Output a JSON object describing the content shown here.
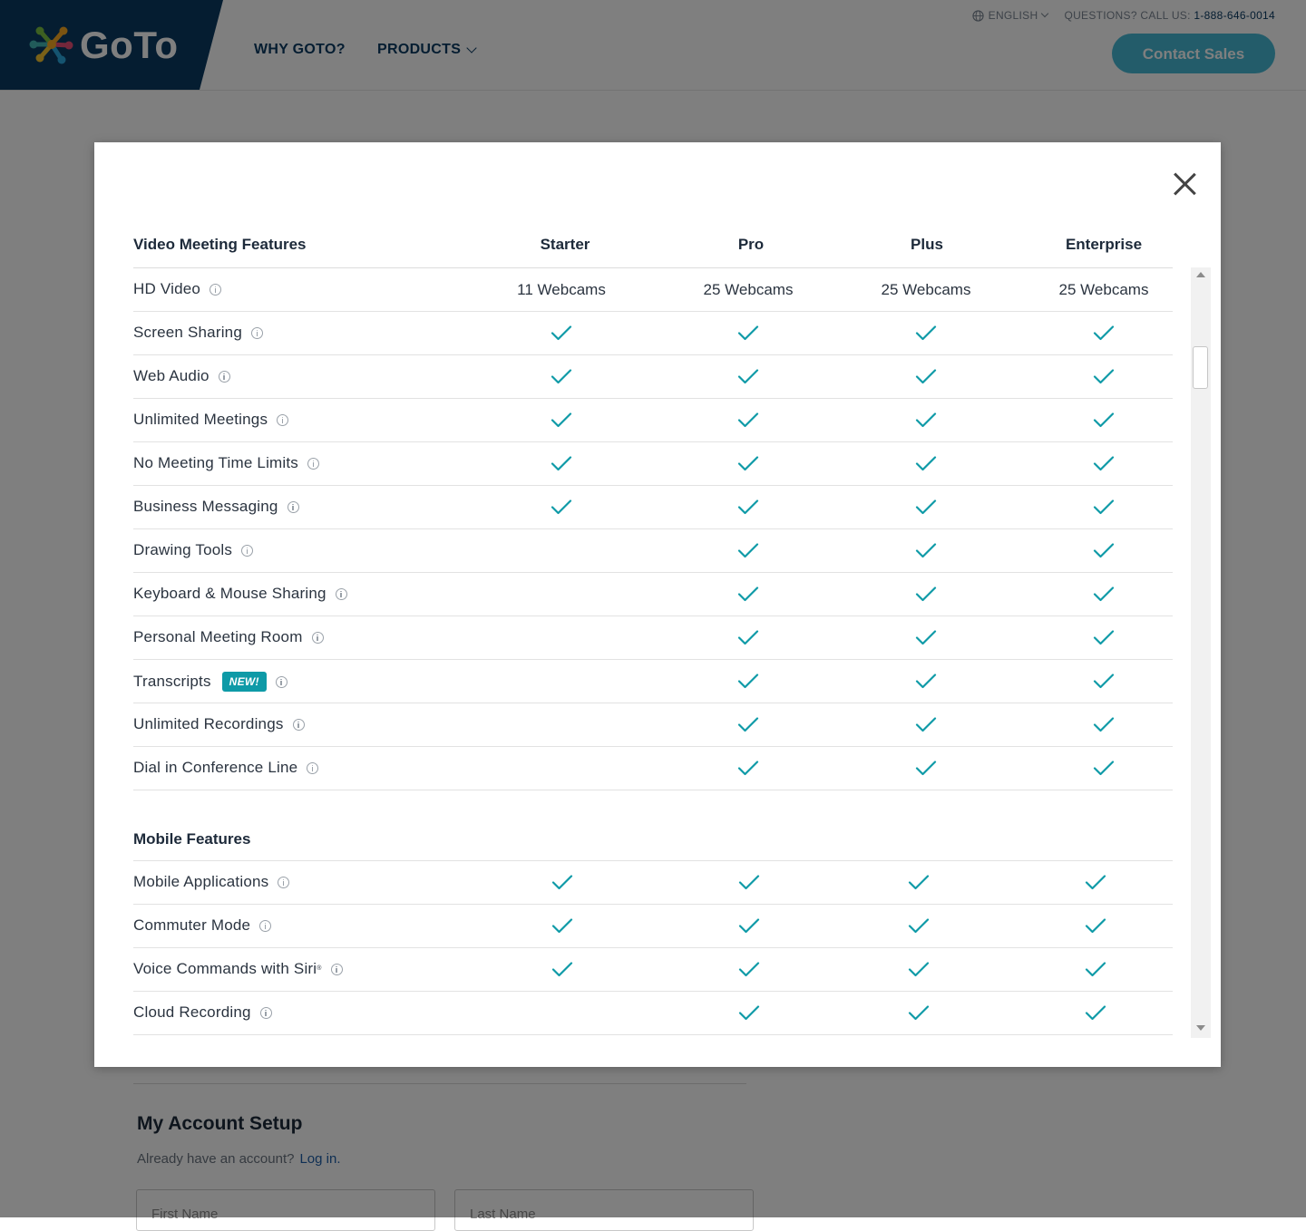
{
  "site": {
    "logo_text": "GoTo",
    "nav": {
      "why": "WHY GOTO?",
      "products": "PRODUCTS"
    },
    "utility": {
      "language": "ENGLISH",
      "questions": "QUESTIONS? CALL US:",
      "phone": "1-888-646-0014"
    },
    "contact_label": "Contact Sales"
  },
  "background": {
    "account_title": "My Account Setup",
    "account_sub": "Already have an account?",
    "login_link": "Log in.",
    "first_name_placeholder": "First Name",
    "last_name_placeholder": "Last Name"
  },
  "modal": {
    "header": {
      "features_title": "Video Meeting Features"
    },
    "plans": [
      "Starter",
      "Pro",
      "Plus",
      "Enterprise"
    ],
    "sections": [
      {
        "title": "",
        "rows": [
          {
            "feature": "HD Video",
            "cells": [
              "11 Webcams",
              "25 Webcams",
              "25 Webcams",
              "25 Webcams"
            ]
          },
          {
            "feature": "Screen Sharing",
            "cells": [
              true,
              true,
              true,
              true
            ]
          },
          {
            "feature": "Web Audio",
            "cells": [
              true,
              true,
              true,
              true
            ]
          },
          {
            "feature": "Unlimited Meetings",
            "cells": [
              true,
              true,
              true,
              true
            ]
          },
          {
            "feature": "No Meeting Time Limits",
            "cells": [
              true,
              true,
              true,
              true
            ]
          },
          {
            "feature": "Business Messaging",
            "cells": [
              true,
              true,
              true,
              true
            ]
          },
          {
            "feature": "Drawing Tools",
            "cells": [
              false,
              true,
              true,
              true
            ]
          },
          {
            "feature": "Keyboard & Mouse Sharing",
            "cells": [
              false,
              true,
              true,
              true
            ]
          },
          {
            "feature": "Personal Meeting Room",
            "cells": [
              false,
              true,
              true,
              true
            ]
          },
          {
            "feature": "Transcripts",
            "badge": "NEW!",
            "cells": [
              false,
              true,
              true,
              true
            ]
          },
          {
            "feature": "Unlimited Recordings",
            "cells": [
              false,
              true,
              true,
              true
            ]
          },
          {
            "feature": "Dial in Conference Line",
            "cells": [
              false,
              true,
              true,
              true
            ]
          }
        ]
      },
      {
        "title": "Mobile Features",
        "rows": [
          {
            "feature": "Mobile Applications",
            "cells": [
              true,
              true,
              true,
              true
            ]
          },
          {
            "feature": "Commuter Mode",
            "cells": [
              true,
              true,
              true,
              true
            ]
          },
          {
            "feature": "Voice Commands with Siri",
            "sup": "®",
            "cells": [
              true,
              true,
              true,
              true
            ]
          },
          {
            "feature": "Cloud Recording",
            "cells": [
              false,
              true,
              true,
              true
            ]
          }
        ]
      }
    ]
  },
  "colors": {
    "brand_navy": "#0b3b63",
    "check_teal": "#0e9aa7",
    "contact_button": "#47b8d4"
  },
  "icons": {
    "close": "close-icon",
    "info": "info-icon",
    "check": "check-icon",
    "globe": "globe-icon"
  }
}
